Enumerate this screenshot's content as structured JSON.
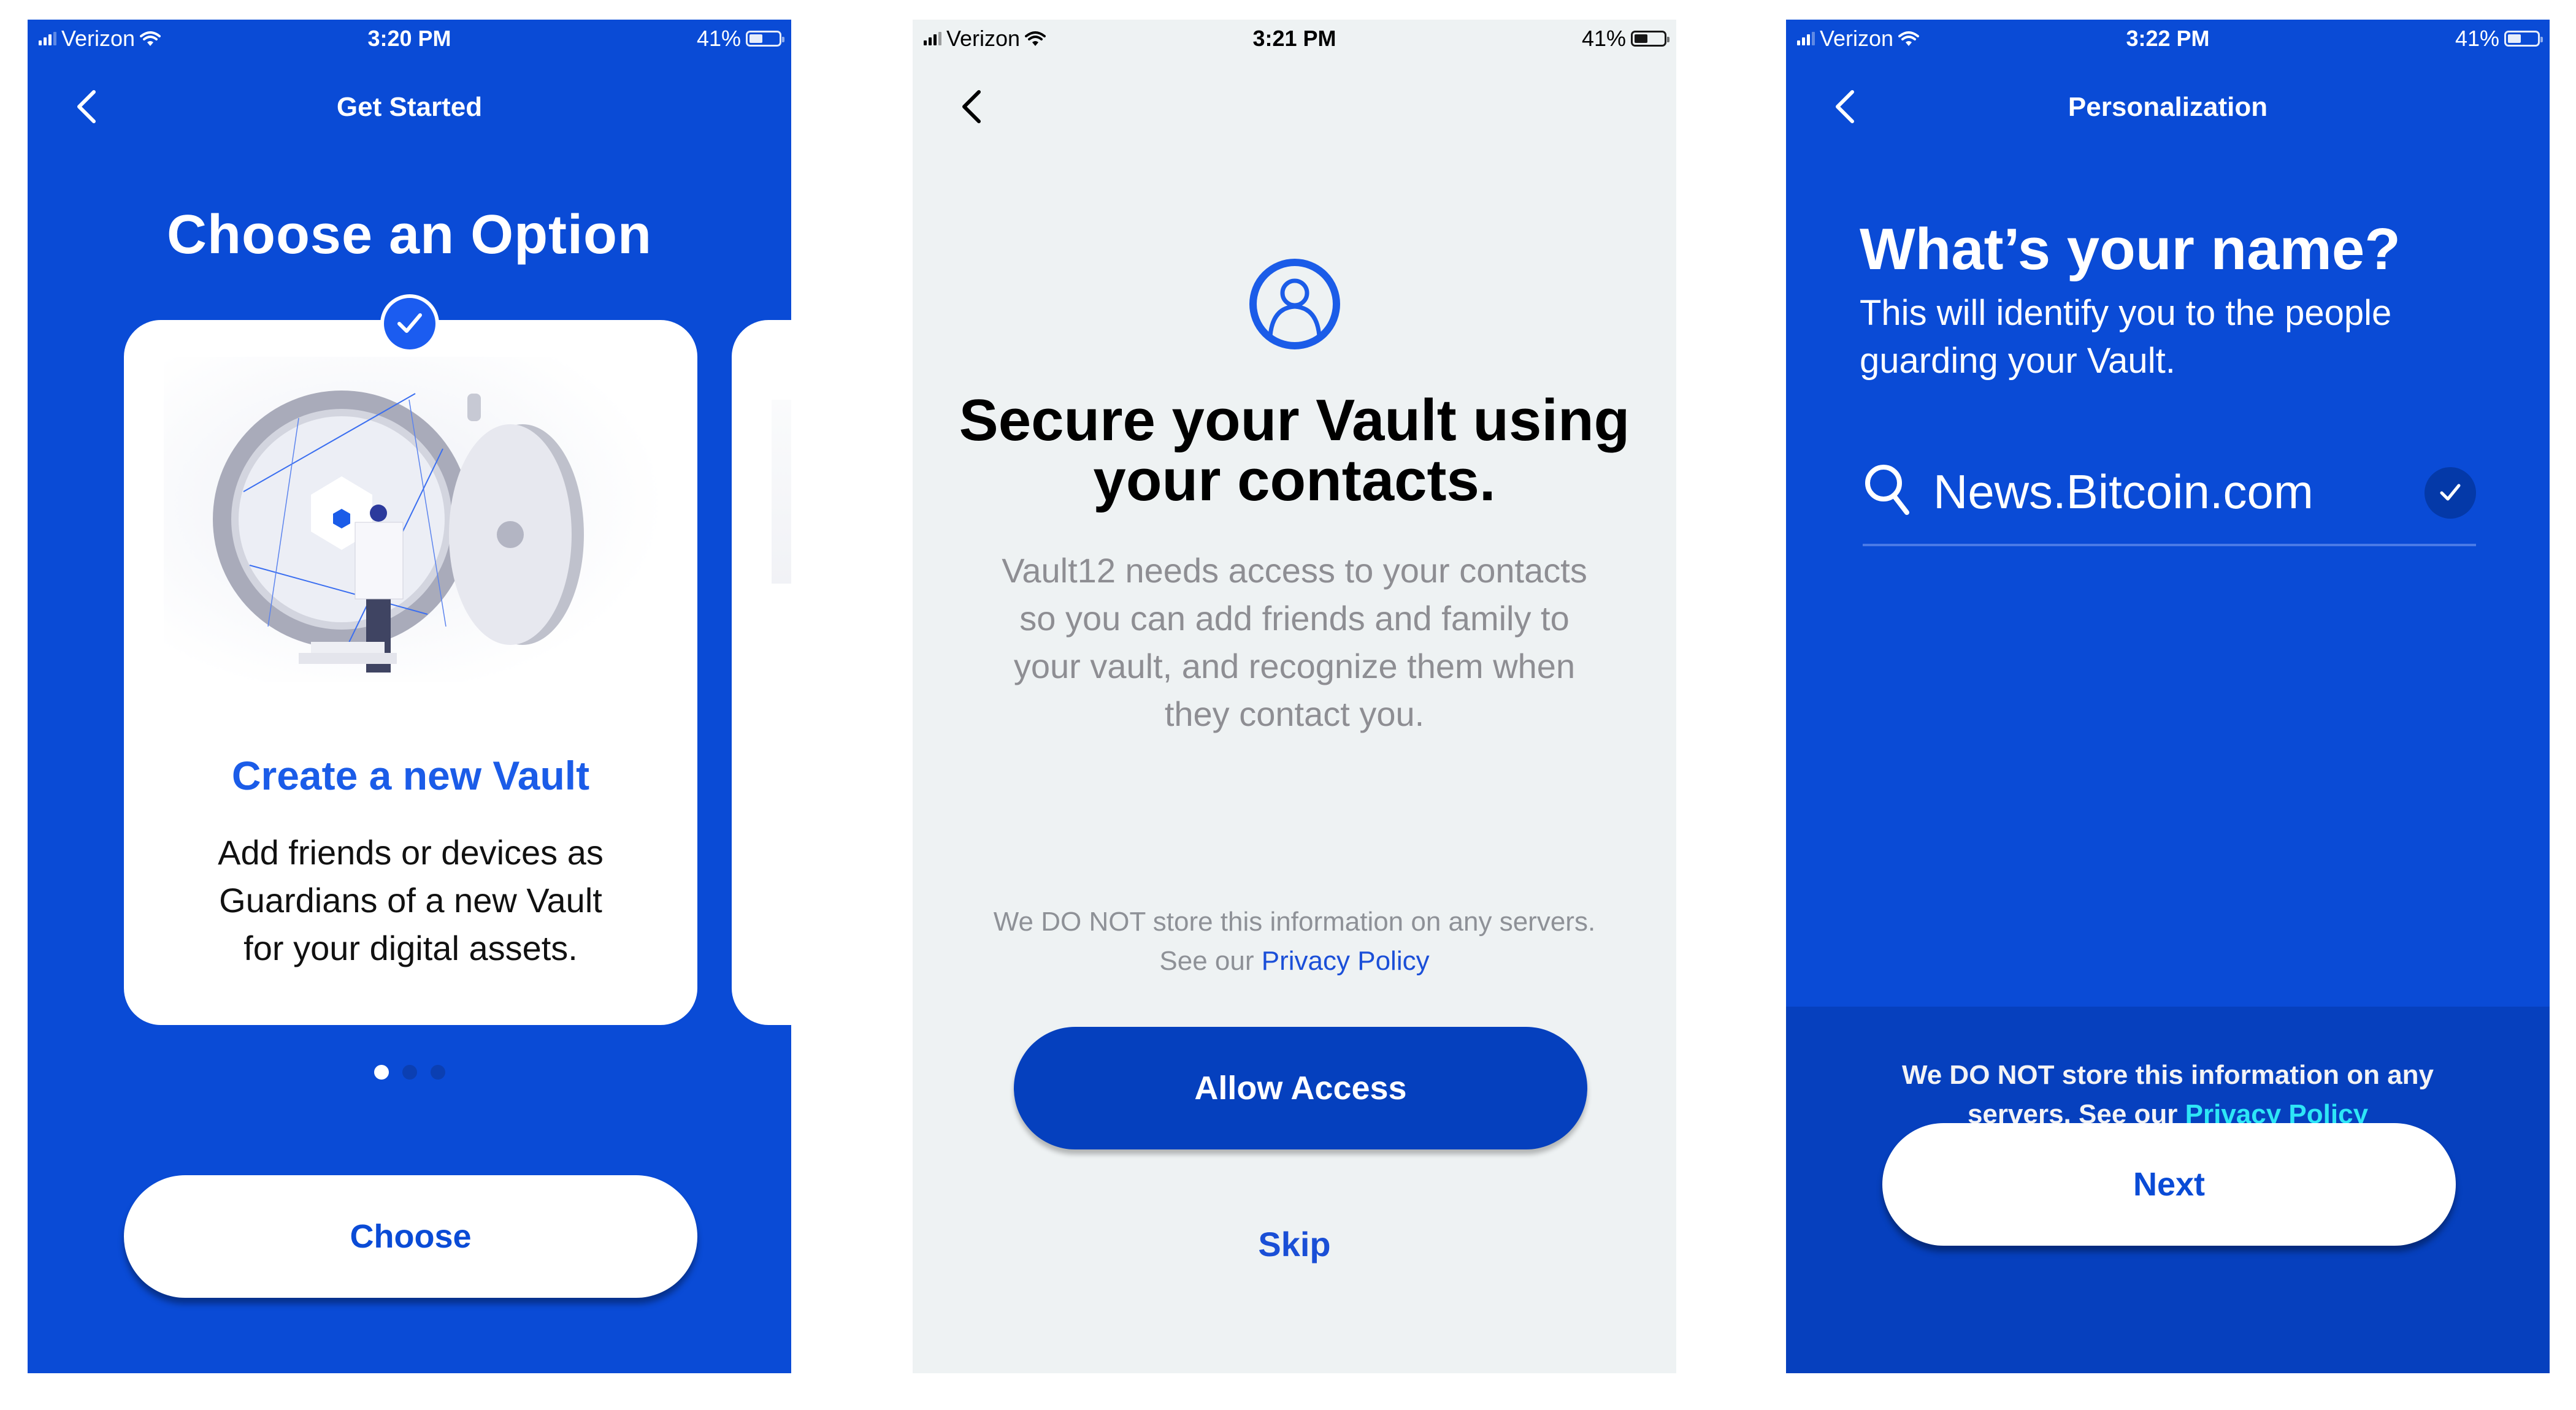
{
  "screens": [
    {
      "status": {
        "carrier": "Verizon",
        "time": "3:20 PM",
        "battery": "41%"
      },
      "nav_title": "Get Started",
      "heading": "Choose an Option",
      "card": {
        "title": "Create a new Vault",
        "body_lines": [
          "Add friends or devices as",
          "Guardians of a new Vault",
          "for your digital assets."
        ],
        "selected": true
      },
      "pager": {
        "count": 3,
        "active_index": 0
      },
      "button": "Choose"
    },
    {
      "status": {
        "carrier": "Verizon",
        "time": "3:21 PM",
        "battery": "41%"
      },
      "heading_lines": [
        "Secure your Vault using",
        "your contacts."
      ],
      "description_lines": [
        "Vault12 needs access to your contacts",
        "so you can add friends and family to",
        "your vault, and recognize them when",
        "they contact you."
      ],
      "privacy_note": {
        "line1": "We DO NOT store this information on any servers.",
        "line2_prefix": "See our ",
        "link": "Privacy Policy"
      },
      "primary_button": "Allow Access",
      "secondary_button": "Skip"
    },
    {
      "status": {
        "carrier": "Verizon",
        "time": "3:22 PM",
        "battery": "41%"
      },
      "nav_title": "Personalization",
      "heading": "What’s your name?",
      "subtitle_lines": [
        "This will identify you to the people",
        "guarding your Vault."
      ],
      "name_field": {
        "value": "News.Bitcoin.com",
        "valid": true
      },
      "privacy_note": {
        "line1": "We DO NOT store this information on any",
        "line2_prefix": "servers. See our ",
        "link": "Privacy Policy"
      },
      "button": "Next"
    }
  ],
  "colors": {
    "brand_blue": "#0a4bd6",
    "dark_blue": "#0540be",
    "light_bg": "#eef2f3",
    "link_cyan": "#2ee6f6",
    "accent_blue": "#1b5ce8"
  }
}
